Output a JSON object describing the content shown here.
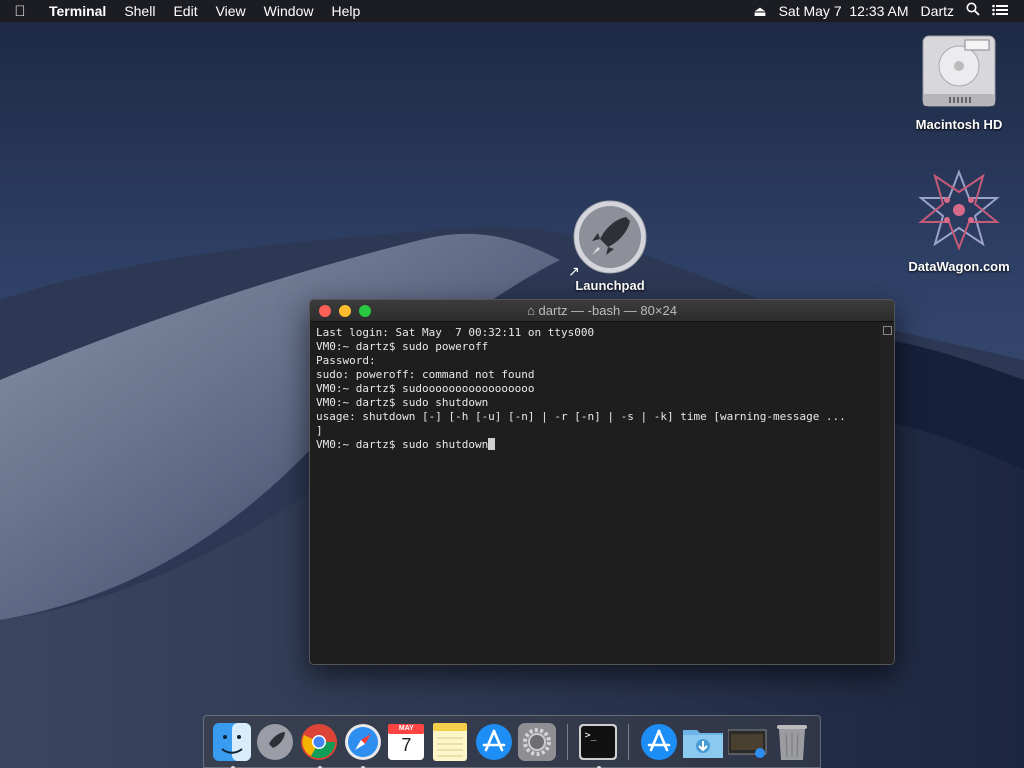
{
  "menubar": {
    "app_name": "Terminal",
    "items": [
      "Shell",
      "Edit",
      "View",
      "Window",
      "Help"
    ],
    "datetime": "Sat May 7  12:33 AM",
    "user": "Dartz"
  },
  "desktop_icons": [
    {
      "label": "Macintosh HD",
      "icon": "hard-drive-icon"
    },
    {
      "label": "DataWagon.com",
      "icon": "datawagon-logo-icon"
    },
    {
      "label": "Launchpad",
      "icon": "launchpad-rocket-icon"
    }
  ],
  "terminal": {
    "title": "dartz — -bash — 80×24",
    "lines": [
      "Last login: Sat May  7 00:32:11 on ttys000",
      "VM0:~ dartz$ sudo poweroff",
      "Password:",
      "sudo: poweroff: command not found",
      "VM0:~ dartz$ sudooooooooooooooooo",
      "VM0:~ dartz$ sudo shutdown",
      "usage: shutdown [-] [-h [-u] [-n] | -r [-n] | -s | -k] time [warning-message ...",
      "]",
      "VM0:~ dartz$ sudo shutdown"
    ],
    "colors": {
      "close": "#ff5f57",
      "minimize": "#febc2e",
      "zoom": "#28c840"
    }
  },
  "dock": {
    "calendar_month": "MAY",
    "calendar_day": "7",
    "terminal_prompt": ">_"
  }
}
